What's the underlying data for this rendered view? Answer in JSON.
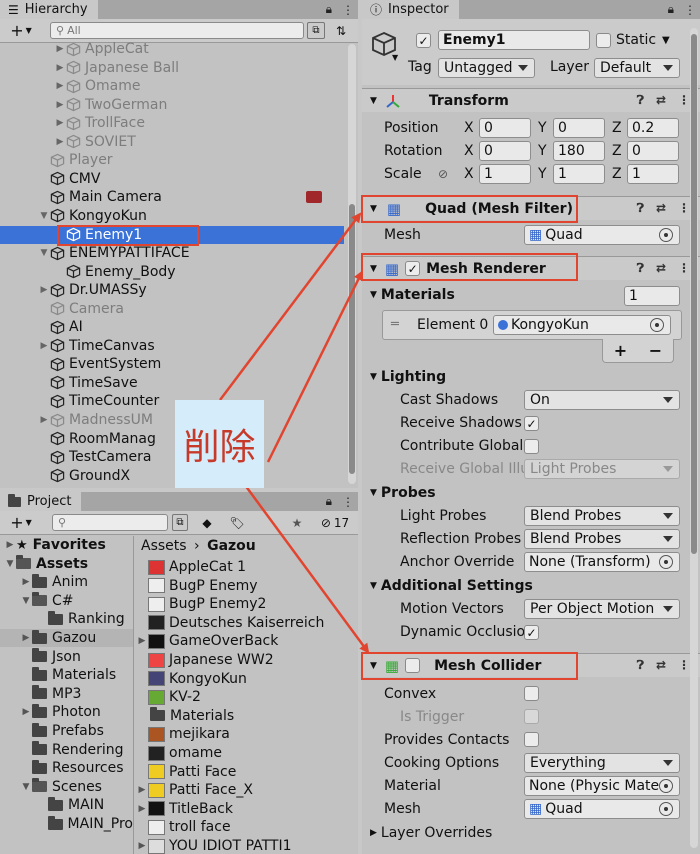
{
  "hierarchy": {
    "tab_label": "Hierarchy",
    "search_placeholder": "All",
    "items": [
      {
        "label": "AppleCat",
        "indent": 3,
        "fold": "right",
        "dim": true
      },
      {
        "label": "Japanese Ball",
        "indent": 3,
        "fold": "right",
        "dim": true
      },
      {
        "label": "Omame",
        "indent": 3,
        "fold": "right",
        "dim": true
      },
      {
        "label": "TwoGerman",
        "indent": 3,
        "fold": "right",
        "dim": true
      },
      {
        "label": "TrollFace",
        "indent": 3,
        "fold": "right",
        "dim": true
      },
      {
        "label": "SOVIET",
        "indent": 3,
        "fold": "right",
        "dim": true
      },
      {
        "label": "Player",
        "indent": 2,
        "fold": "",
        "dim": true
      },
      {
        "label": "CMV",
        "indent": 2,
        "fold": "",
        "dim": false
      },
      {
        "label": "Main Camera",
        "indent": 2,
        "fold": "",
        "dim": false
      },
      {
        "label": "KongyoKun",
        "indent": 2,
        "fold": "down",
        "dim": false
      },
      {
        "label": "Enemy1",
        "indent": 3,
        "fold": "",
        "dim": false,
        "selected": true
      },
      {
        "label": "ENEMYPATTIFACE",
        "indent": 2,
        "fold": "down",
        "dim": false
      },
      {
        "label": "Enemy_Body",
        "indent": 3,
        "fold": "",
        "dim": false
      },
      {
        "label": "Dr.UMASSy",
        "indent": 2,
        "fold": "right",
        "dim": false
      },
      {
        "label": "Camera",
        "indent": 2,
        "fold": "",
        "dim": true
      },
      {
        "label": "AI",
        "indent": 2,
        "fold": "",
        "dim": false
      },
      {
        "label": "TimeCanvas",
        "indent": 2,
        "fold": "right",
        "dim": false
      },
      {
        "label": "EventSystem",
        "indent": 2,
        "fold": "",
        "dim": false
      },
      {
        "label": "TimeSave",
        "indent": 2,
        "fold": "",
        "dim": false
      },
      {
        "label": "TimeCounter",
        "indent": 2,
        "fold": "",
        "dim": false
      },
      {
        "label": "MadnessUM",
        "indent": 2,
        "fold": "right",
        "dim": true
      },
      {
        "label": "RoomManag",
        "indent": 2,
        "fold": "",
        "dim": false
      },
      {
        "label": "TestCamera",
        "indent": 2,
        "fold": "",
        "dim": false
      },
      {
        "label": "GroundX",
        "indent": 2,
        "fold": "",
        "dim": false
      }
    ]
  },
  "annotation": {
    "text": "削除"
  },
  "project": {
    "tab_label": "Project",
    "badge_count": "17",
    "tree": [
      {
        "label": "Favorites",
        "indent": 0,
        "fold": "right",
        "kind": "star",
        "bold": true
      },
      {
        "label": "Assets",
        "indent": 0,
        "fold": "down",
        "kind": "folder-open",
        "bold": true
      },
      {
        "label": "Anim",
        "indent": 1,
        "fold": "right",
        "kind": "folder"
      },
      {
        "label": "C#",
        "indent": 1,
        "fold": "down",
        "kind": "folder-open"
      },
      {
        "label": "Ranking",
        "indent": 2,
        "fold": "",
        "kind": "folder"
      },
      {
        "label": "Gazou",
        "indent": 1,
        "fold": "right",
        "kind": "folder",
        "selected": true
      },
      {
        "label": "Json",
        "indent": 1,
        "fold": "",
        "kind": "folder"
      },
      {
        "label": "Materials",
        "indent": 1,
        "fold": "",
        "kind": "folder"
      },
      {
        "label": "MP3",
        "indent": 1,
        "fold": "",
        "kind": "folder"
      },
      {
        "label": "Photon",
        "indent": 1,
        "fold": "right",
        "kind": "folder"
      },
      {
        "label": "Prefabs",
        "indent": 1,
        "fold": "",
        "kind": "folder"
      },
      {
        "label": "Rendering",
        "indent": 1,
        "fold": "",
        "kind": "folder"
      },
      {
        "label": "Resources",
        "indent": 1,
        "fold": "",
        "kind": "folder"
      },
      {
        "label": "Scenes",
        "indent": 1,
        "fold": "down",
        "kind": "folder-open"
      },
      {
        "label": "MAIN",
        "indent": 2,
        "fold": "",
        "kind": "folder"
      },
      {
        "label": "MAIN_Pro",
        "indent": 2,
        "fold": "",
        "kind": "folder"
      }
    ],
    "breadcrumb": {
      "root": "Assets",
      "sep": "›",
      "current": "Gazou"
    },
    "files": [
      {
        "label": "AppleCat 1",
        "thumb": "#d33",
        "fold": false
      },
      {
        "label": "BugP Enemy",
        "thumb": "#eee",
        "fold": false
      },
      {
        "label": "BugP Enemy2",
        "thumb": "#eee",
        "fold": false
      },
      {
        "label": "Deutsches Kaiserreich",
        "thumb": "#222",
        "fold": false
      },
      {
        "label": "GameOverBack",
        "thumb": "#111",
        "fold": true
      },
      {
        "label": "Japanese WW2",
        "thumb": "#e44",
        "fold": false
      },
      {
        "label": "KongyoKun",
        "thumb": "#447",
        "fold": false
      },
      {
        "label": "KV-2",
        "thumb": "#6a3",
        "fold": false
      },
      {
        "label": "Materials",
        "thumb": "folder",
        "fold": false
      },
      {
        "label": "mejikara",
        "thumb": "#a52",
        "fold": false
      },
      {
        "label": "omame",
        "thumb": "#222",
        "fold": false
      },
      {
        "label": "Patti Face",
        "thumb": "#ec2",
        "fold": false
      },
      {
        "label": "Patti Face_X",
        "thumb": "#ec2",
        "fold": true
      },
      {
        "label": "TitleBack",
        "thumb": "#111",
        "fold": true
      },
      {
        "label": "troll face",
        "thumb": "#eee",
        "fold": false
      },
      {
        "label": "YOU IDIOT PATTI1",
        "thumb": "#ddd",
        "fold": true
      }
    ]
  },
  "inspector": {
    "tab_label": "Inspector",
    "object_name": "Enemy1",
    "static_label": "Static",
    "tag_label": "Tag",
    "tag_value": "Untagged",
    "layer_label": "Layer",
    "layer_value": "Default",
    "transform": {
      "title": "Transform",
      "position_label": "Position",
      "rotation_label": "Rotation",
      "scale_label": "Scale",
      "position": [
        "0",
        "0",
        "0.2"
      ],
      "rotation": [
        "0",
        "180",
        "0"
      ],
      "scale": [
        "1",
        "1",
        "1"
      ],
      "axes": [
        "X",
        "Y",
        "Z"
      ]
    },
    "mesh_filter": {
      "title": "Quad (Mesh Filter)",
      "mesh_label": "Mesh",
      "mesh_value": "Quad"
    },
    "mesh_renderer": {
      "title": "Mesh Renderer",
      "materials_label": "Materials",
      "materials_count": "1",
      "element_label": "Element 0",
      "element_value": "KongyoKun",
      "plus": "+",
      "minus": "−",
      "lighting": {
        "title": "Lighting",
        "cast_label": "Cast Shadows",
        "cast_value": "On",
        "receive_label": "Receive Shadows",
        "contribute_label": "Contribute Global I",
        "receive_gi_label": "Receive Global Illu",
        "receive_gi_value": "Light Probes"
      },
      "probes": {
        "title": "Probes",
        "light_label": "Light Probes",
        "light_value": "Blend Probes",
        "reflection_label": "Reflection Probes",
        "reflection_value": "Blend Probes",
        "anchor_label": "Anchor Override",
        "anchor_value": "None (Transform)"
      },
      "additional": {
        "title": "Additional Settings",
        "motion_label": "Motion Vectors",
        "motion_value": "Per Object Motion",
        "dynamic_label": "Dynamic Occlusio"
      }
    },
    "mesh_collider": {
      "title": "Mesh Collider",
      "convex_label": "Convex",
      "trigger_label": "Is Trigger",
      "contacts_label": "Provides Contacts",
      "cooking_label": "Cooking Options",
      "cooking_value": "Everything",
      "material_label": "Material",
      "material_value": "None (Physic Materi",
      "mesh_label": "Mesh",
      "mesh_value": "Quad",
      "layer_overrides_label": "Layer Overrides"
    }
  },
  "colors": {
    "selection": "#3a72d8",
    "annotation_red": "#e2452f",
    "annotation_bg": "#d5ecfb"
  }
}
